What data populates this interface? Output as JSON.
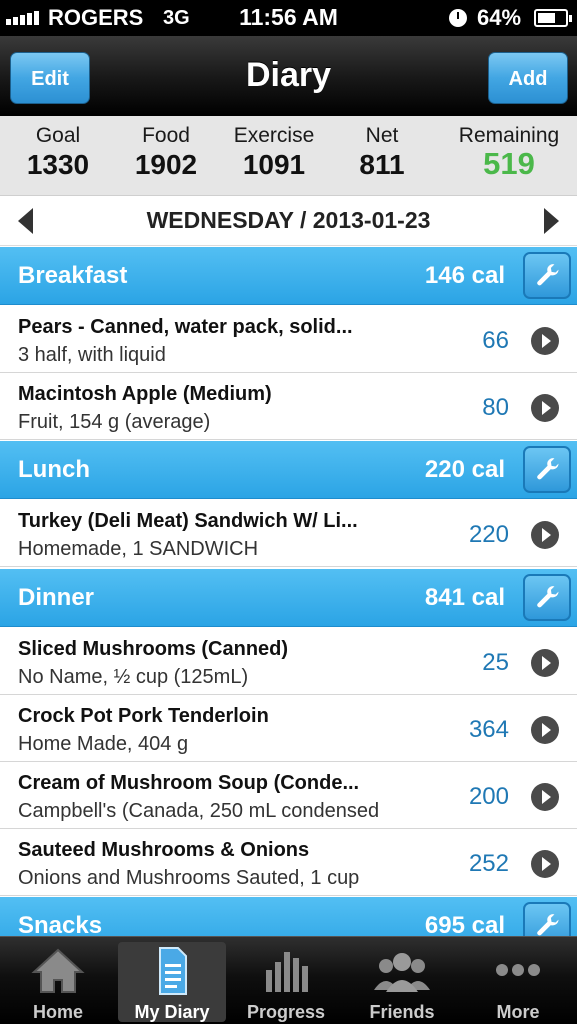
{
  "status_bar": {
    "carrier": "ROGERS",
    "network": "3G",
    "time": "11:56 AM",
    "battery": "64%"
  },
  "nav": {
    "title": "Diary",
    "edit_label": "Edit",
    "add_label": "Add"
  },
  "summary": [
    {
      "label": "Goal",
      "value": "1330"
    },
    {
      "label": "Food",
      "value": "1902"
    },
    {
      "label": "Exercise",
      "value": "1091"
    },
    {
      "label": "Net",
      "value": "811"
    },
    {
      "label": "Remaining",
      "value": "519"
    }
  ],
  "date": "WEDNESDAY / 2013-01-23",
  "meals": {
    "breakfast": {
      "name": "Breakfast",
      "calories": "146 cal",
      "items": [
        {
          "name": "Pears - Canned, water pack, solid...",
          "detail": "3 half, with liquid",
          "calories": "66"
        },
        {
          "name": "Macintosh Apple (Medium)",
          "detail": "Fruit, 154 g (average)",
          "calories": "80"
        }
      ]
    },
    "lunch": {
      "name": "Lunch",
      "calories": "220 cal",
      "items": [
        {
          "name": "Turkey (Deli Meat) Sandwich W/ Li...",
          "detail": "Homemade, 1 SANDWICH",
          "calories": "220"
        }
      ]
    },
    "dinner": {
      "name": "Dinner",
      "calories": "841 cal",
      "items": [
        {
          "name": "Sliced Mushrooms (Canned)",
          "detail": "No Name, ½ cup (125mL)",
          "calories": "25"
        },
        {
          "name": "Crock Pot Pork Tenderloin",
          "detail": "Home Made, 404 g",
          "calories": "364"
        },
        {
          "name": "Cream of Mushroom Soup (Conde...",
          "detail": "Campbell's (Canada, 250 mL condensed",
          "calories": "200"
        },
        {
          "name": "Sauteed Mushrooms & Onions",
          "detail": "Onions and Mushrooms Sauted, 1 cup",
          "calories": "252"
        }
      ]
    },
    "snacks": {
      "name": "Snacks",
      "calories": "695 cal"
    }
  },
  "tabs": [
    {
      "label": "Home",
      "icon": "home-icon",
      "active": false
    },
    {
      "label": "My Diary",
      "icon": "diary-icon",
      "active": true
    },
    {
      "label": "Progress",
      "icon": "progress-icon",
      "active": false
    },
    {
      "label": "Friends",
      "icon": "friends-icon",
      "active": false
    },
    {
      "label": "More",
      "icon": "more-icon",
      "active": false
    }
  ],
  "colors": {
    "accent_blue": "#2ba4e5",
    "remaining_green": "#4bb84a",
    "calorie_text": "#1f78b4"
  }
}
